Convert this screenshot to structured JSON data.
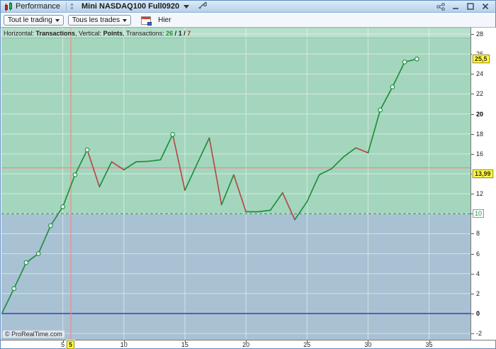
{
  "window": {
    "tab_performance": "Performance",
    "tab_instrument": "Mini NASDAQ100 Full0920",
    "icons": [
      "candlestick-icon",
      "dropdown-arrow-icon",
      "wrench-icon",
      "share-icon",
      "minimize-icon",
      "maximize-icon",
      "close-icon"
    ]
  },
  "toolbar": {
    "trading_scope_button": "Tout le trading",
    "trades_filter_button": "Tous les trades",
    "period_label": "Hier",
    "period_icon": "calendar-icon"
  },
  "status_line": {
    "segments": [
      {
        "text": "Horizontal: ",
        "bold": false,
        "color": "#1a1a1a"
      },
      {
        "text": "Transactions",
        "bold": true,
        "color": "#1a1a1a"
      },
      {
        "text": ", ",
        "bold": false,
        "color": "#1a1a1a"
      },
      {
        "text": "Vertical: ",
        "bold": false,
        "color": "#1a1a1a"
      },
      {
        "text": "Points",
        "bold": true,
        "color": "#1a1a1a"
      },
      {
        "text": ", ",
        "bold": false,
        "color": "#1a1a1a"
      },
      {
        "text": "Transactions: ",
        "bold": false,
        "color": "#1a1a1a"
      },
      {
        "text": "26",
        "bold": true,
        "color": "#1e8c3c"
      },
      {
        "text": " / ",
        "bold": true,
        "color": "#1a1a1a"
      },
      {
        "text": "1",
        "bold": true,
        "color": "#1a1a1a"
      },
      {
        "text": " / ",
        "bold": true,
        "color": "#1a1a1a"
      },
      {
        "text": "7",
        "bold": true,
        "color": "#c03020"
      }
    ]
  },
  "copyright": "© ProRealTime.com",
  "chart_data": {
    "type": "line",
    "xlabel": "Transactions",
    "ylabel": "Points",
    "x": [
      0,
      1,
      2,
      3,
      4,
      5,
      6,
      7,
      8,
      9,
      10,
      11,
      12,
      13,
      14,
      15,
      16,
      17,
      18,
      19,
      20,
      21,
      22,
      23,
      24,
      25,
      26,
      27,
      28,
      29,
      30,
      31,
      32,
      33,
      34
    ],
    "values": [
      0,
      2.5,
      5.1,
      6.0,
      8.8,
      10.7,
      13.9,
      16.4,
      12.7,
      15.2,
      14.4,
      15.2,
      15.25,
      15.4,
      17.95,
      12.35,
      15.0,
      17.6,
      10.9,
      13.9,
      10.2,
      10.2,
      10.35,
      12.1,
      9.4,
      11.2,
      13.9,
      14.5,
      15.7,
      16.6,
      16.1,
      20.4,
      22.7,
      25.2,
      25.5
    ],
    "marker_indices": [
      1,
      2,
      3,
      4,
      5,
      6,
      7,
      14,
      31,
      32,
      33,
      34
    ],
    "x_ticks": [
      5,
      10,
      15,
      20,
      25,
      30,
      35
    ],
    "y_ticks": [
      -2,
      0,
      2,
      4,
      6,
      8,
      10,
      12,
      14,
      16,
      18,
      20,
      22,
      24,
      26,
      28
    ],
    "bold_y_ticks": [
      0,
      20
    ],
    "xlim": [
      0,
      38.4
    ],
    "ylim": [
      -2.8,
      28.6
    ],
    "grid": true,
    "zones": {
      "boundary_value": 10,
      "upper_color": "#a4d6bd",
      "lower_color": "#a8c2d3"
    },
    "zero_line_value": 0,
    "threshold_badge_label": "10",
    "last_value_badge_label": "25,5",
    "last_value": 25.5,
    "crosshair": {
      "x": 5.66,
      "y_line_value": 14.6,
      "x_badge_label": "5",
      "y_badge_label": "13,99",
      "y_badge_value": 13.99
    },
    "colors": {
      "gain_segment": "#1f8f3f",
      "loss_segment": "#b54a4a",
      "marker_fill": "#eafaef",
      "threshold_dashed_line": "#2ea35a",
      "zero_line": "#3a3ac8",
      "crosshair": "#ef8d8d",
      "gridline": "rgba(255,255,255,0.5)"
    }
  }
}
